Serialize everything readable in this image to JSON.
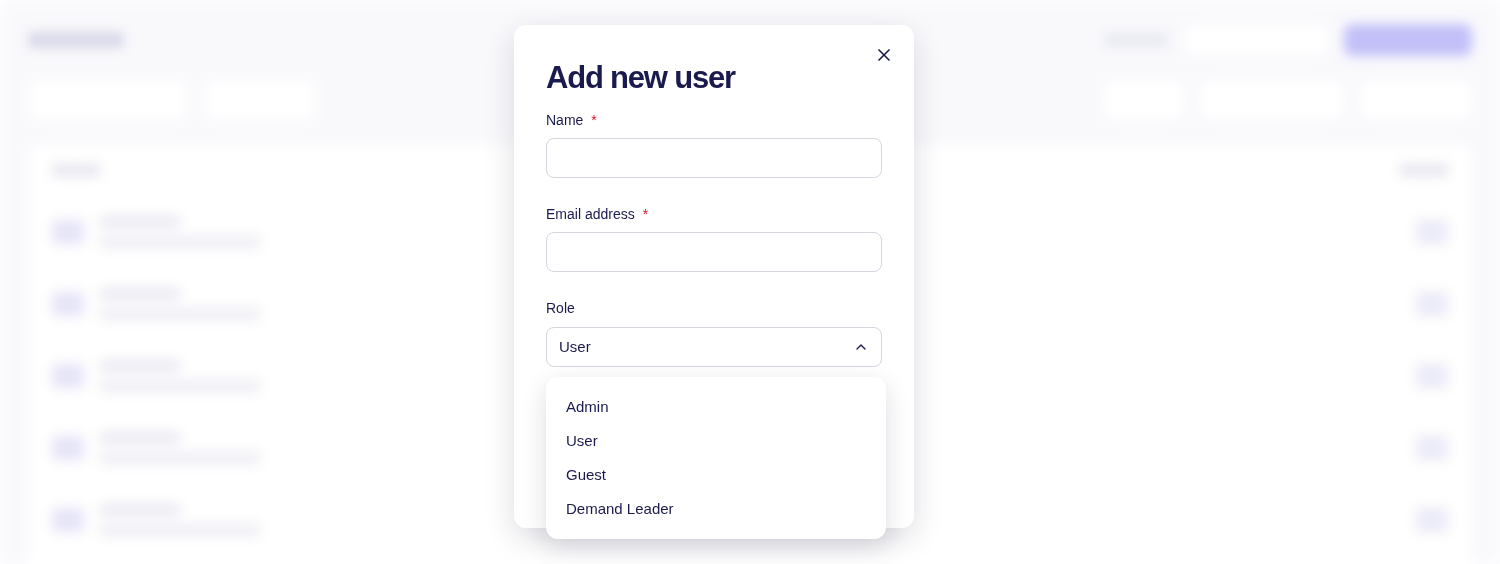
{
  "dialog": {
    "title": "Add new user",
    "fields": [
      {
        "kind": "text",
        "label": "Name",
        "required_mark": "*"
      },
      {
        "kind": "text",
        "label": "Email address",
        "required_mark": "*"
      },
      {
        "kind": "select",
        "label": "Role",
        "value": "User",
        "open": true
      }
    ],
    "role_options": [
      "Admin",
      "User",
      "Guest",
      "Demand Leader"
    ]
  }
}
